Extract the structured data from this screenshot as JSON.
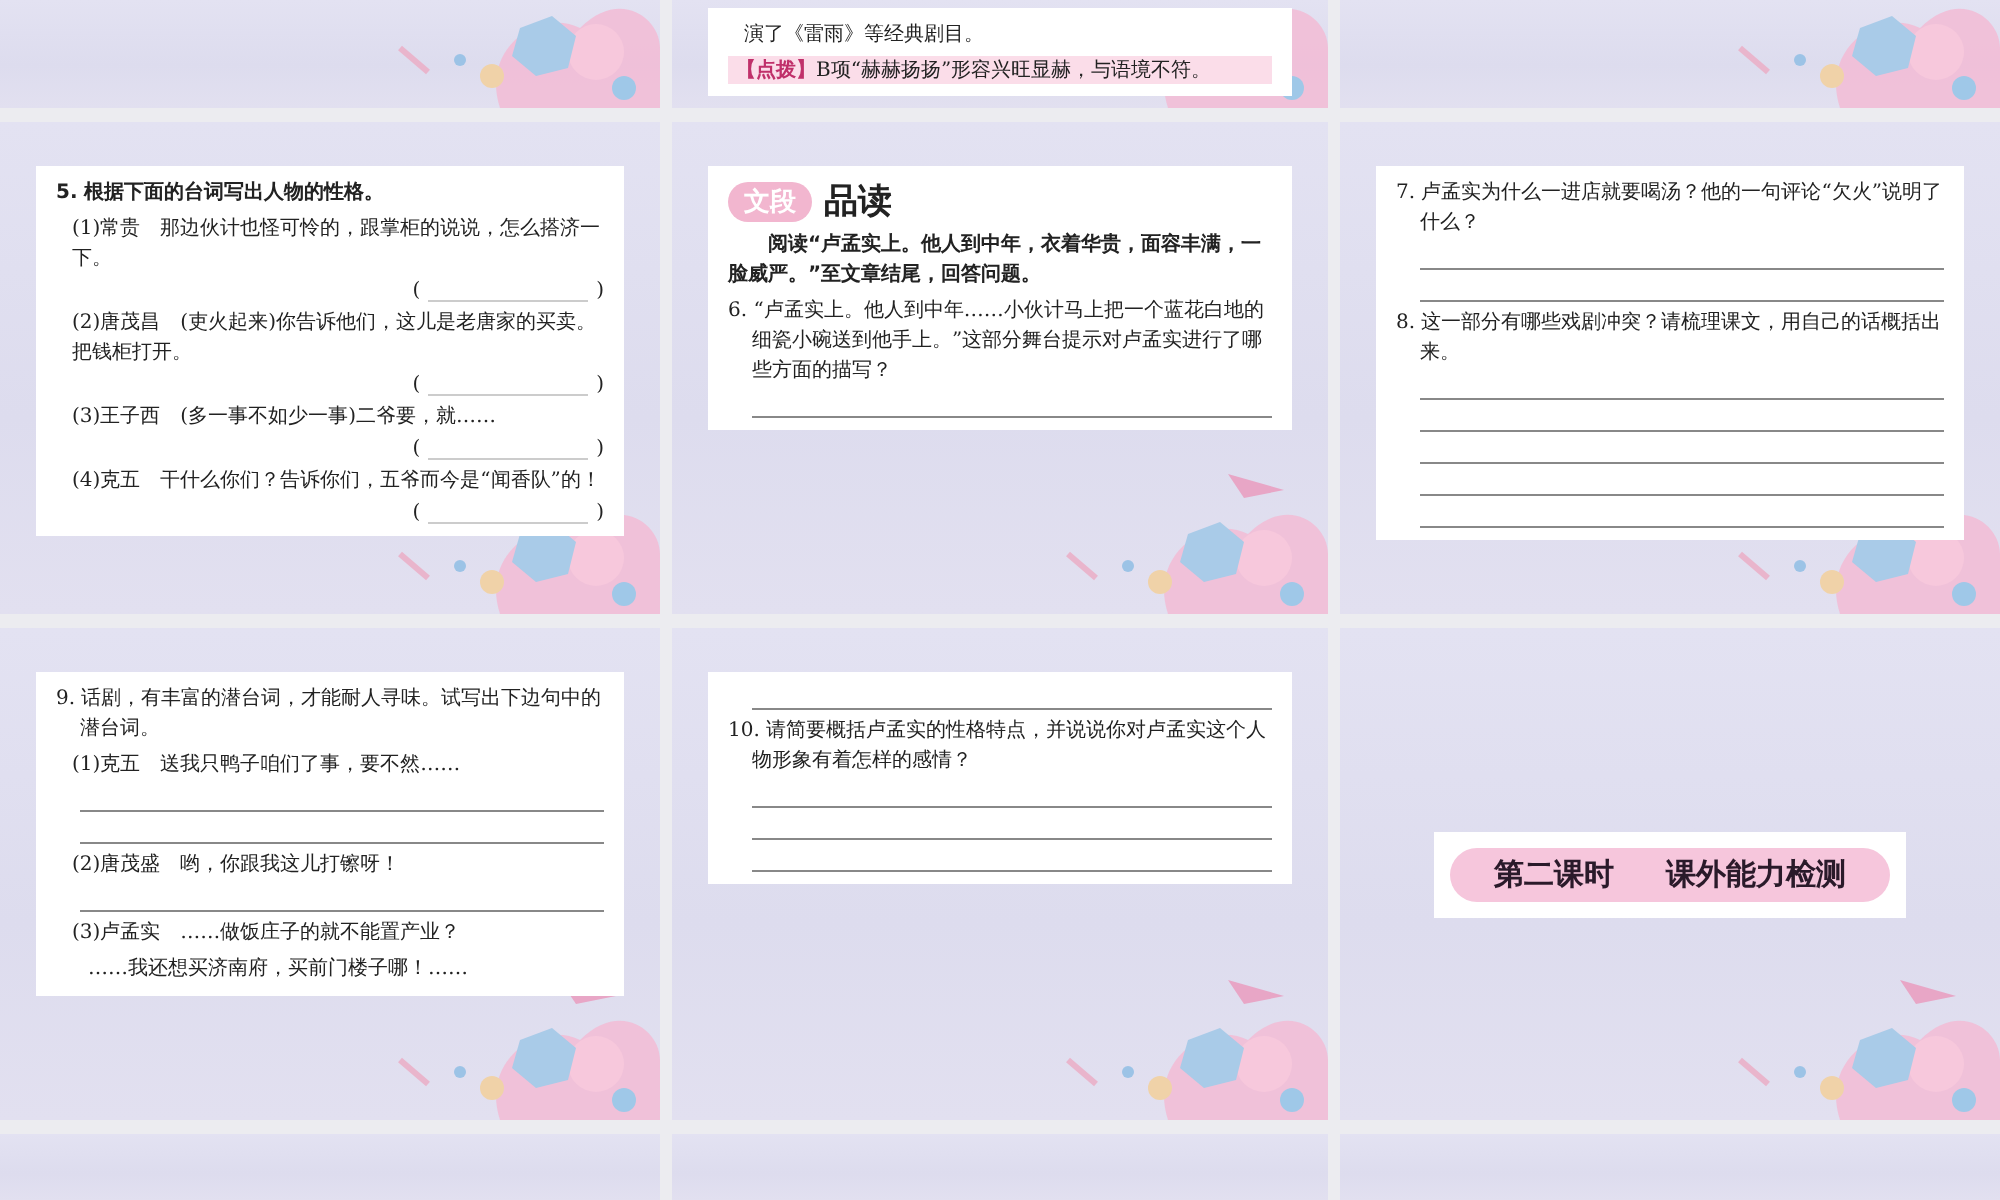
{
  "slides": [
    {
      "kind": "blank"
    },
    {
      "kind": "worksheet",
      "blocks": [
        {
          "kind": "sub",
          "text": "演了《雷雨》等经典剧目。"
        },
        {
          "kind": "hint",
          "label": "【点拨】",
          "text": "B项“赫赫扬扬”形容兴旺显赫，与语境不符。"
        }
      ]
    },
    {
      "kind": "blank"
    },
    {
      "kind": "worksheet",
      "blocks": [
        {
          "kind": "heading",
          "text": "5. 根据下面的台词写出人物的性格。"
        },
        {
          "kind": "sub",
          "text": "(1)常贵　那边伙计也怪可怜的，跟掌柜的说说，怎么搭济一下。"
        },
        {
          "kind": "answer",
          "open": "(",
          "close": ")"
        },
        {
          "kind": "sub",
          "text": "(2)唐茂昌　(吏火起来)你告诉他们，这儿是老唐家的买卖。把钱柜打开。"
        },
        {
          "kind": "answer",
          "open": "(",
          "close": ")"
        },
        {
          "kind": "sub",
          "text": "(3)王子西　(多一事不如少一事)二爷要，就……"
        },
        {
          "kind": "answer",
          "open": "(",
          "close": ")"
        },
        {
          "kind": "sub",
          "text": "(4)克五　干什么你们？告诉你们，五爷而今是“闻香队”的！"
        },
        {
          "kind": "answer",
          "open": "(",
          "close": ")"
        }
      ]
    },
    {
      "kind": "worksheet",
      "blocks": [
        {
          "kind": "title",
          "badge": "文段",
          "text": "品读"
        },
        {
          "kind": "paragraph",
          "text": "阅读“卢孟实上。他人到中年，衣着华贵，面容丰满，一脸威严。”至文章结尾，回答问题。"
        },
        {
          "kind": "question",
          "text": "6. “卢孟实上。他人到中年……小伙计马上把一个蓝花白地的细瓷小碗送到他手上。”这部分舞台提示对卢孟实进行了哪些方面的描写？"
        },
        {
          "kind": "line"
        }
      ]
    },
    {
      "kind": "worksheet",
      "blocks": [
        {
          "kind": "question",
          "text": "7. 卢孟实为什么一进店就要喝汤？他的一句评论“欠火”说明了什么？"
        },
        {
          "kind": "line"
        },
        {
          "kind": "line"
        },
        {
          "kind": "question",
          "text": "8. 这一部分有哪些戏剧冲突？请梳理课文，用自己的话概括出来。"
        },
        {
          "kind": "line"
        },
        {
          "kind": "line"
        },
        {
          "kind": "line"
        },
        {
          "kind": "line"
        },
        {
          "kind": "line"
        }
      ]
    },
    {
      "kind": "worksheet",
      "blocks": [
        {
          "kind": "question",
          "text": "9. 话剧，有丰富的潜台词，才能耐人寻味。试写出下边句中的潜台词。"
        },
        {
          "kind": "sub",
          "text": "(1)克五　送我只鸭子咱们了事，要不然……"
        },
        {
          "kind": "line"
        },
        {
          "kind": "line"
        },
        {
          "kind": "sub",
          "text": "(2)唐茂盛　哟，你跟我这儿打镲呀！"
        },
        {
          "kind": "line"
        },
        {
          "kind": "sub",
          "text": "(3)卢孟实　……做饭庄子的就不能置产业？"
        },
        {
          "kind": "subcont",
          "text": "……我还想买济南府，买前门楼子哪！……"
        }
      ]
    },
    {
      "kind": "worksheet",
      "blocks": [
        {
          "kind": "line"
        },
        {
          "kind": "question",
          "text": "10. 请简要概括卢孟实的性格特点，并说说你对卢孟实这个人物形象有着怎样的感情？"
        },
        {
          "kind": "line"
        },
        {
          "kind": "line"
        },
        {
          "kind": "line"
        }
      ]
    },
    {
      "kind": "section",
      "texts": [
        "第二课时",
        "课外能力检测"
      ]
    },
    {
      "kind": "blank"
    },
    {
      "kind": "blank"
    },
    {
      "kind": "blank"
    }
  ]
}
